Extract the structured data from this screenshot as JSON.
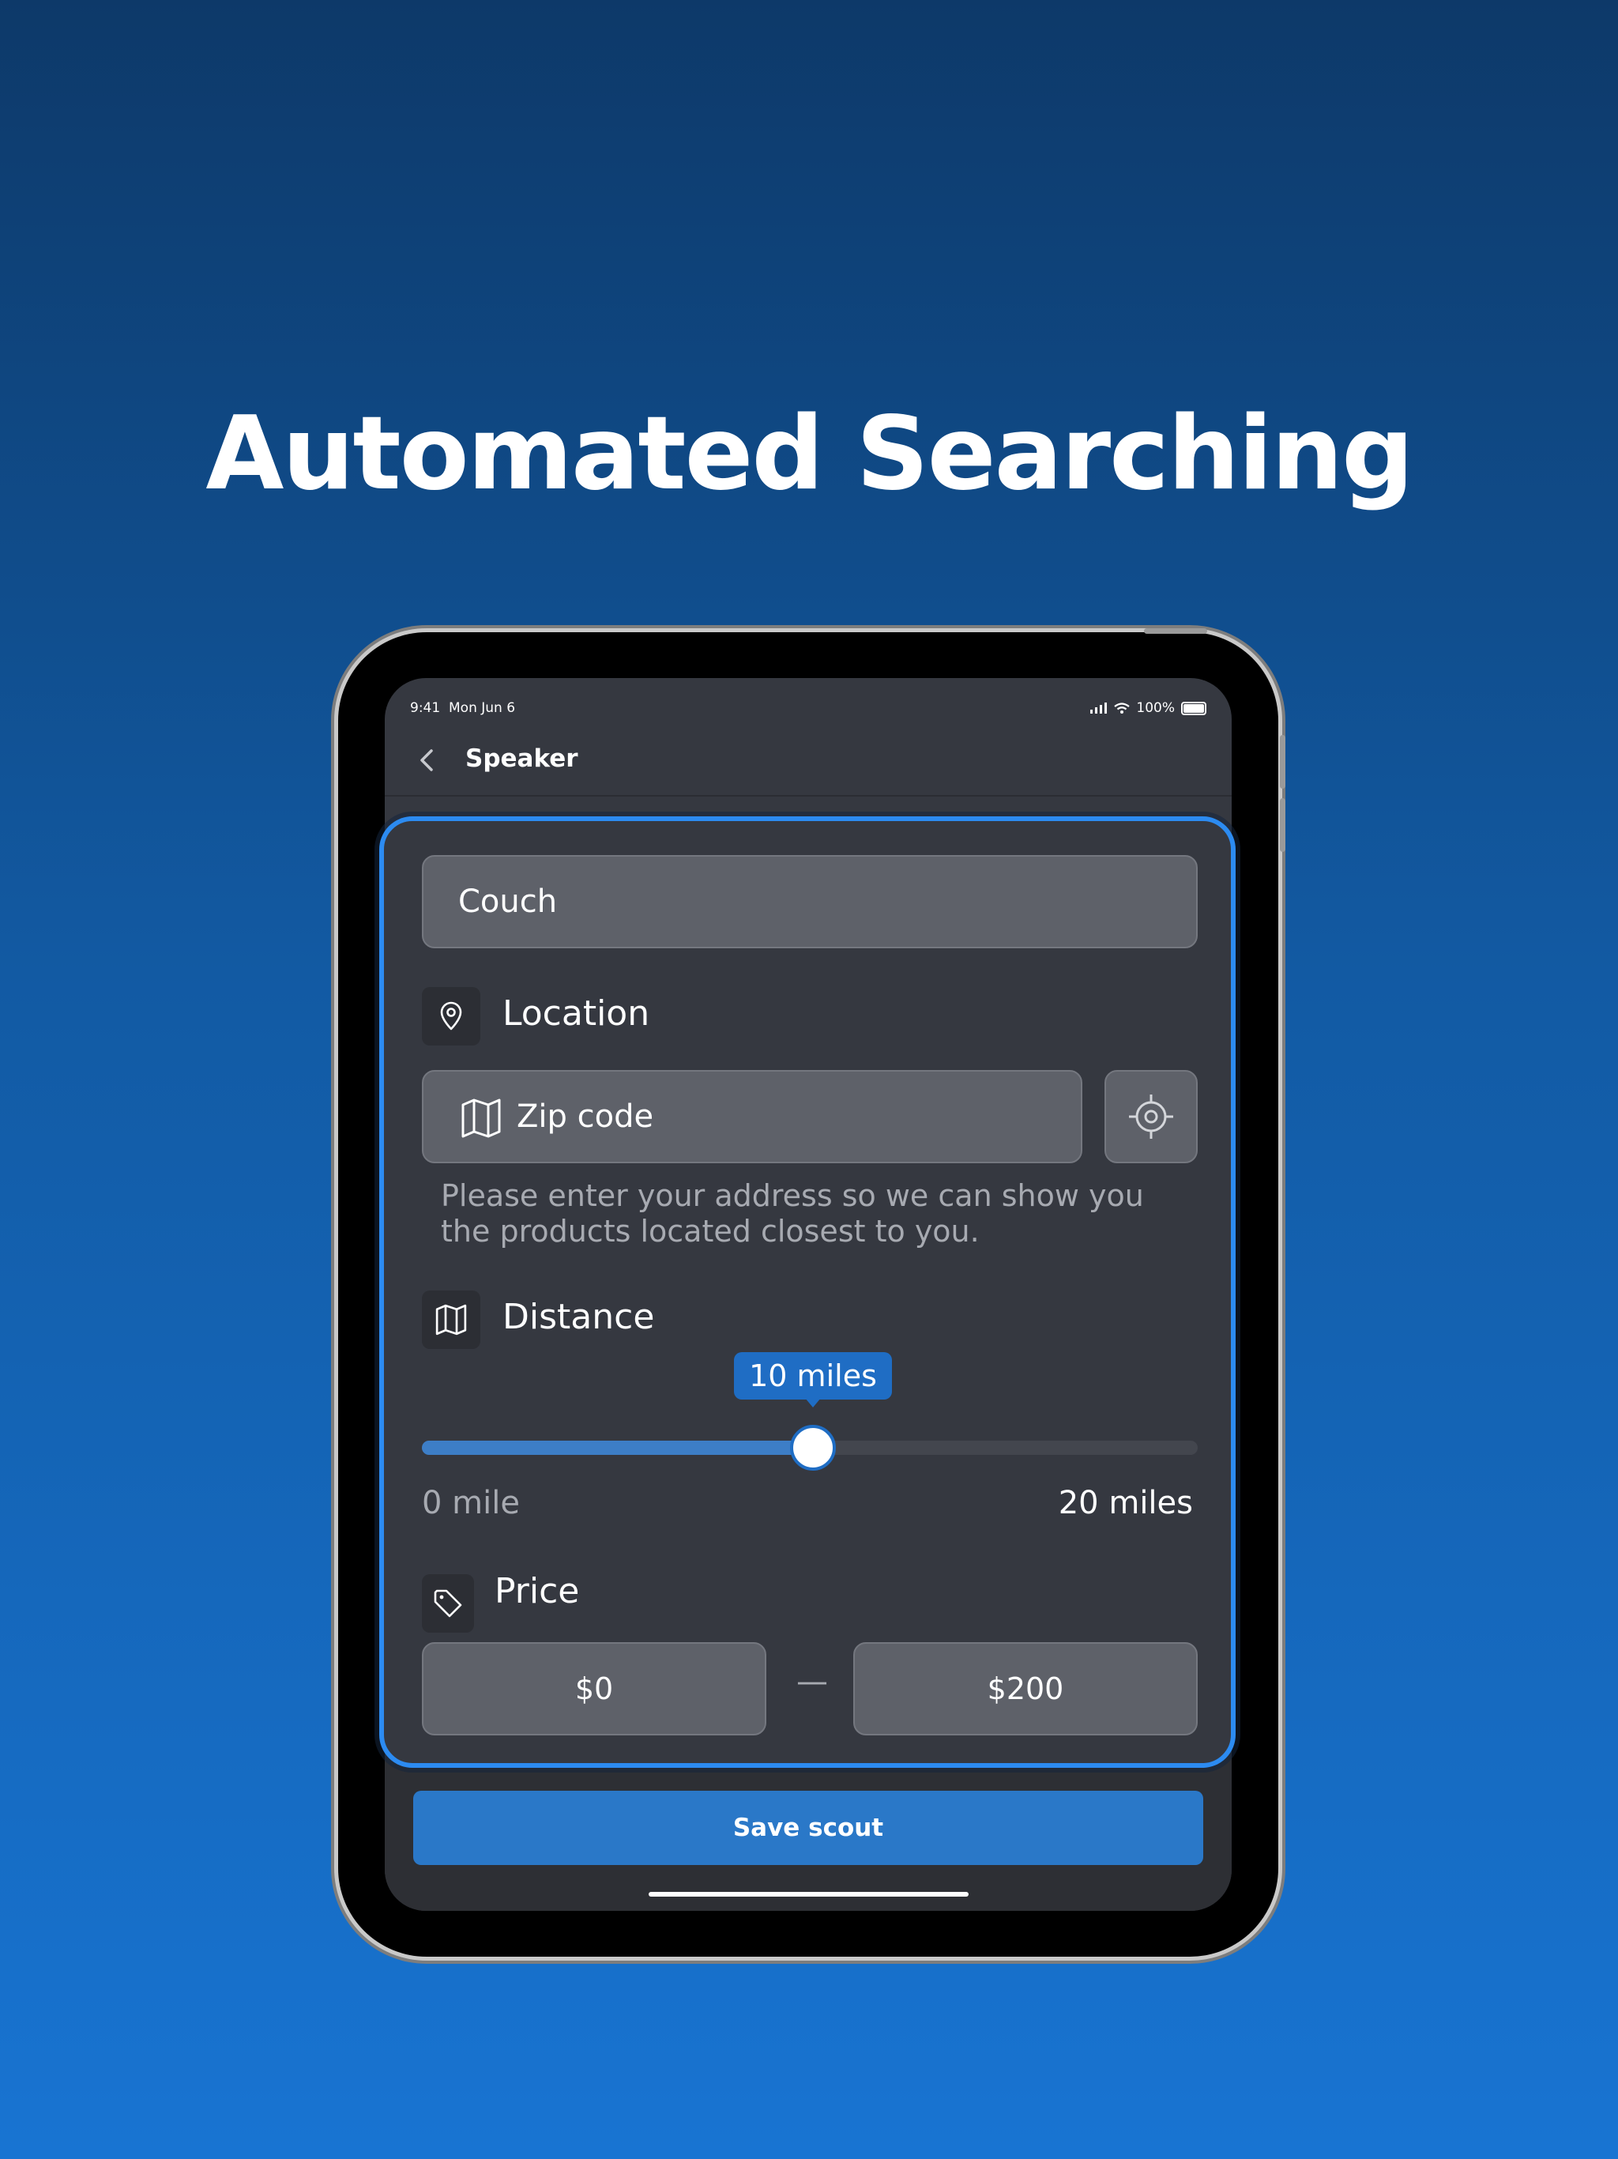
{
  "headline": "Automated Searching",
  "status_bar": {
    "time": "9:41",
    "date": "Mon Jun 6",
    "battery": "100%"
  },
  "navbar": {
    "title": "Speaker"
  },
  "form": {
    "search_value": "Couch",
    "location_label": "Location",
    "zip_placeholder": "Zip code",
    "helper_text": "Please enter your address so we can show you the products located closest to you.",
    "distance_label": "Distance",
    "distance_value": "10 miles",
    "distance_fraction": 0.5,
    "distance_min_label": "0 mile",
    "distance_max_label": "20 miles",
    "price_label": "Price",
    "price_min": "$0",
    "price_separator": "—",
    "price_max": "$200"
  },
  "save_label": "Save scout",
  "colors": {
    "accent": "#2c8bf1",
    "button": "#2a78c8",
    "panel": "#353840"
  }
}
